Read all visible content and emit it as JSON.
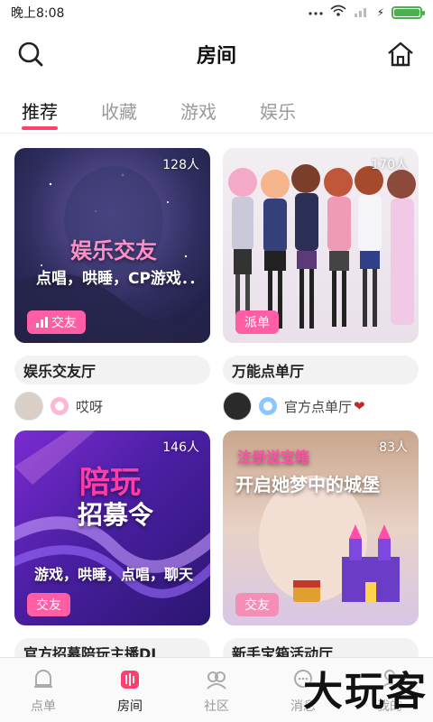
{
  "statusbar": {
    "time": "晚上8:08",
    "battery_level": 1.0
  },
  "header": {
    "title": "房间"
  },
  "tabs": [
    {
      "label": "推荐",
      "active": true
    },
    {
      "label": "收藏",
      "active": false
    },
    {
      "label": "游戏",
      "active": false
    },
    {
      "label": "娱乐",
      "active": false
    }
  ],
  "rooms": [
    {
      "count": "128人",
      "tag": "交友",
      "tag_icon": "bars-icon",
      "name": "娱乐交友厅",
      "host": "哎呀",
      "thumb_title": "娱乐交友",
      "thumb_subtitle": "点唱，哄睡，CP游戏．．"
    },
    {
      "count": "170人",
      "tag": "派单",
      "name": "万能点单厅",
      "host": "官方点单厅",
      "host_suffix": "❤"
    },
    {
      "count": "146人",
      "tag": "交友",
      "name": "官方招募陪玩主播DJ",
      "thumb_title": "陪玩",
      "thumb_title2": "招募令",
      "thumb_subtitle": "游戏，哄睡，点唱，聊天"
    },
    {
      "count": "83人",
      "tag": "交友",
      "name": "新手宝箱活动厅",
      "thumb_title": "注册送宝箱",
      "thumb_subtitle": "开启她梦中的城堡"
    }
  ],
  "bottom_nav": [
    {
      "label": "点单",
      "icon": "bell-icon",
      "active": false
    },
    {
      "label": "房间",
      "icon": "mic-icon",
      "active": true
    },
    {
      "label": "社区",
      "icon": "community-icon",
      "active": false
    },
    {
      "label": "消息",
      "icon": "chat-icon",
      "active": false
    },
    {
      "label": "我的",
      "icon": "user-icon",
      "active": false
    }
  ],
  "watermark": "大玩客",
  "colors": {
    "accent": "#ff3f6e",
    "tag": "#ff5ea4"
  }
}
